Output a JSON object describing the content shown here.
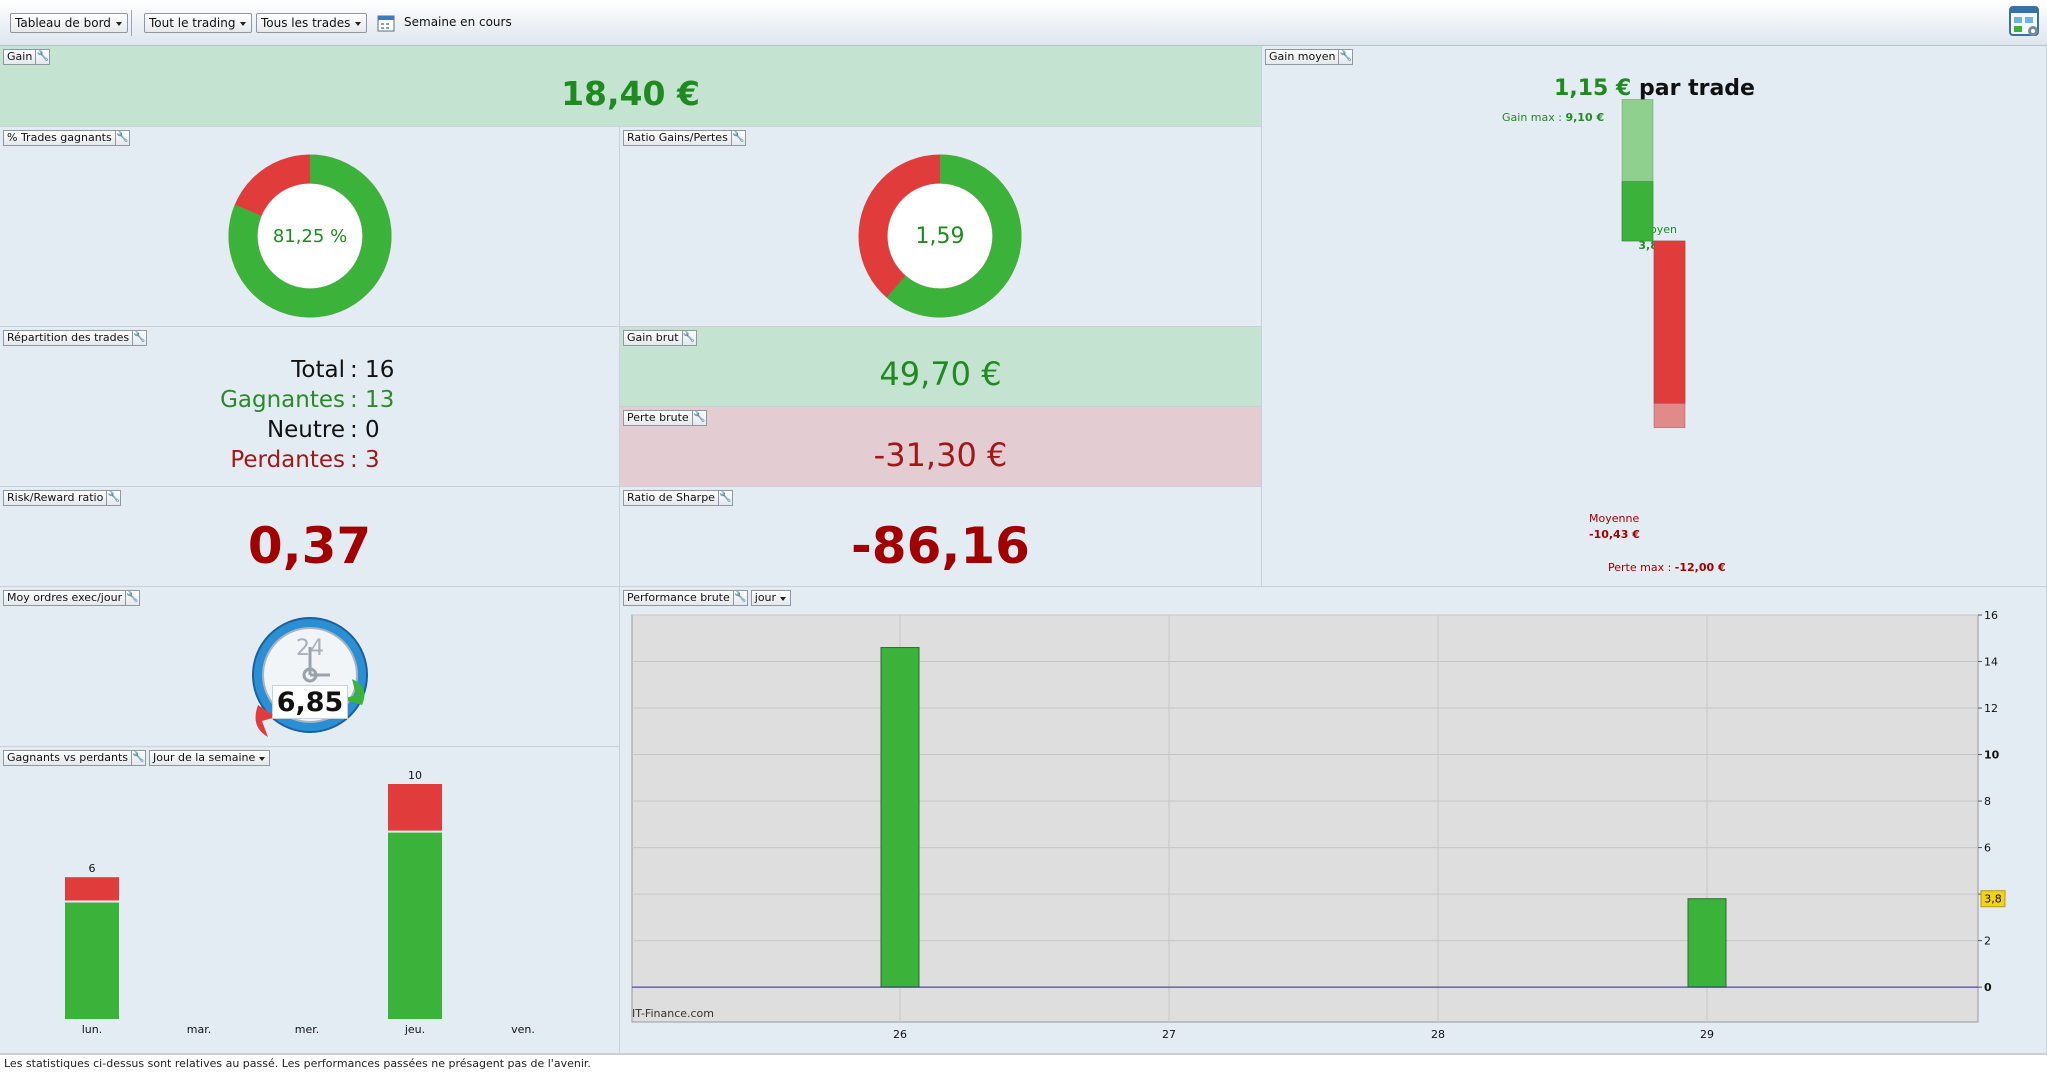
{
  "toolbar": {
    "dashboard_select": "Tableau de bord",
    "trading_select": "Tout le trading",
    "trades_select": "Tous les trades",
    "period_label": "Semaine en cours"
  },
  "gain": {
    "title": "Gain",
    "value": "18,40 €"
  },
  "gain_moyen": {
    "title": "Gain moyen",
    "value": "1,15 €",
    "suffix": "par trade",
    "gain_max_label": "Gain max",
    "gain_max_sep": " : ",
    "gain_max_value": "9,10 €",
    "moyen_label": "Moyen",
    "moyen_value": "3,82 €",
    "moyenne_label": "Moyenne",
    "moyenne_value": "-10,43 €",
    "perte_max_label": "Perte max",
    "perte_max_sep": " : ",
    "perte_max_value": "-12,00 €",
    "gain_max": 9.1,
    "gain_avg": 3.82,
    "loss_max": -12.0,
    "loss_avg": -10.43
  },
  "pct_gagnants": {
    "title": "% Trades gagnants",
    "value": "81,25 %",
    "win_fraction": 0.8125
  },
  "ratio_gains": {
    "title": "Ratio Gains/Pertes",
    "value": "1,59",
    "gain_share": 0.6136
  },
  "repartition": {
    "title": "Répartition des trades",
    "rows": [
      {
        "label": "Total",
        "value": ": 16",
        "color": "#111111"
      },
      {
        "label": "Gagnantes",
        "value": ": 13",
        "color": "#2a8a2a"
      },
      {
        "label": "Neutre",
        "value": ": 0",
        "color": "#111111"
      },
      {
        "label": "Perdantes",
        "value": ": 3",
        "color": "#a01818"
      }
    ]
  },
  "gain_brut": {
    "title": "Gain brut",
    "value": "49,70 €"
  },
  "perte_brute": {
    "title": "Perte brute",
    "value": "-31,30 €"
  },
  "risk_reward": {
    "title": "Risk/Reward ratio",
    "value": "0,37"
  },
  "sharpe": {
    "title": "Ratio de Sharpe",
    "value": "-86,16"
  },
  "moy_ordres": {
    "title": "Moy ordres exec/jour",
    "value": "6,85",
    "dial_label": "24"
  },
  "gvp": {
    "title": "Gagnants vs perdants",
    "select": "Jour de la semaine",
    "categories": [
      "lun.",
      "mar.",
      "mer.",
      "jeu.",
      "ven."
    ],
    "totals": [
      6,
      0,
      0,
      10,
      0
    ],
    "winners": [
      5,
      0,
      0,
      8,
      0
    ],
    "losers": [
      1,
      0,
      0,
      2,
      0
    ]
  },
  "performance": {
    "title": "Performance brute",
    "select": "jour",
    "watermark": "IT-Finance.com",
    "current_label": "3,8"
  },
  "footer": "Les statistiques ci-dessus sont relatives au passé. Les performances passées ne présagent pas de l'avenir.",
  "chart_data": [
    {
      "type": "bar",
      "title": "Performance brute",
      "categories": [
        "26",
        "27",
        "28",
        "29"
      ],
      "values": [
        14.6,
        0,
        0,
        3.8
      ],
      "ylim": [
        -1.5,
        16
      ],
      "yticks": [
        0,
        2,
        4,
        6,
        8,
        10,
        12,
        14,
        16
      ],
      "ytick_labels": [
        "0",
        "2",
        "",
        "6",
        "8",
        "10",
        "12",
        "14",
        "16"
      ],
      "grid": true
    },
    {
      "type": "bar",
      "title": "Gagnants vs perdants",
      "categories": [
        "lun.",
        "mar.",
        "mer.",
        "jeu.",
        "ven."
      ],
      "series": [
        {
          "values": [
            5,
            0,
            0,
            8,
            0
          ]
        },
        {
          "values": [
            1,
            0,
            0,
            2,
            0
          ]
        }
      ],
      "data_labels": [
        "6",
        "",
        "",
        "10",
        ""
      ]
    }
  ],
  "colors": {
    "green": "#3bb33b",
    "red": "#e03c3c",
    "dark_red": "#a00000",
    "dark_green": "#1f8a1f",
    "tag": "#f3d21c"
  }
}
